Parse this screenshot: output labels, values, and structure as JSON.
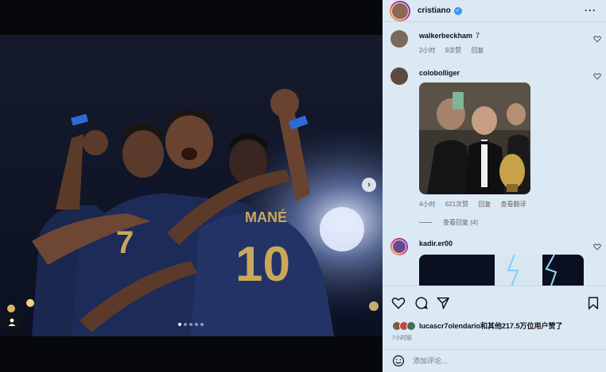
{
  "post": {
    "username": "cristiano",
    "verified": true,
    "carousel": {
      "total": 5,
      "current": 1
    }
  },
  "icons": {
    "more": "more-options-icon",
    "next": "chevron-right-icon",
    "tag": "user-tag-icon",
    "heart": "heart-icon",
    "comment": "comment-icon",
    "share": "share-icon",
    "save": "bookmark-icon",
    "emoji": "emoji-icon"
  },
  "photo": {
    "jersey_name": "MANÉ",
    "jersey_number": "10",
    "arm_number": "7"
  },
  "comments": [
    {
      "username": "walkerbeckham",
      "text": "7",
      "time": "2小时",
      "likes": "9次赞",
      "reply": "回复"
    },
    {
      "username": "colobolliger",
      "text": "",
      "time": "4小时",
      "likes": "621次赞",
      "reply": "回复",
      "translate": "查看翻译",
      "view_replies": "查看回复 (4)"
    },
    {
      "username": "kadir.er00",
      "text": ""
    }
  ],
  "likes_text": "lucascr7olendario和其他217.5万位用户赞了",
  "timestamp": "7小时前",
  "add_comment": {
    "placeholder": "添加评论..."
  },
  "colors": {
    "panel_bg": "#dbe9f5",
    "verified": "#3897f0",
    "divider": "#c6d6e3"
  }
}
